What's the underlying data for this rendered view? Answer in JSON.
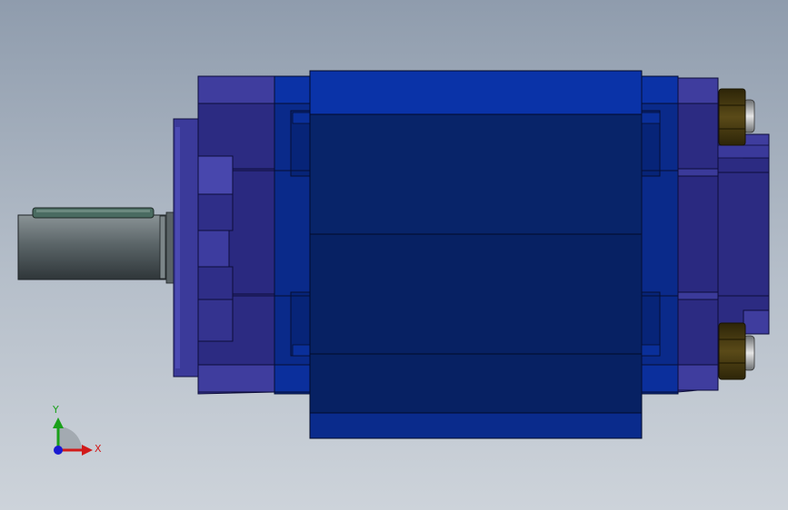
{
  "viewport": {
    "background_top": "#8f9cad",
    "background_bottom": "#cdd3da"
  },
  "triad": {
    "x_label": "X",
    "y_label": "Y",
    "x_color": "#d11a1a",
    "y_color": "#1aa01a",
    "z_color": "#1a1ad1"
  },
  "model": {
    "housing_color": "#0a2a8a",
    "housing_dark": "#062166",
    "flange_color": "#3d3c9a",
    "shaft_color": "#4c5558",
    "nut_color": "#4a3d14"
  }
}
